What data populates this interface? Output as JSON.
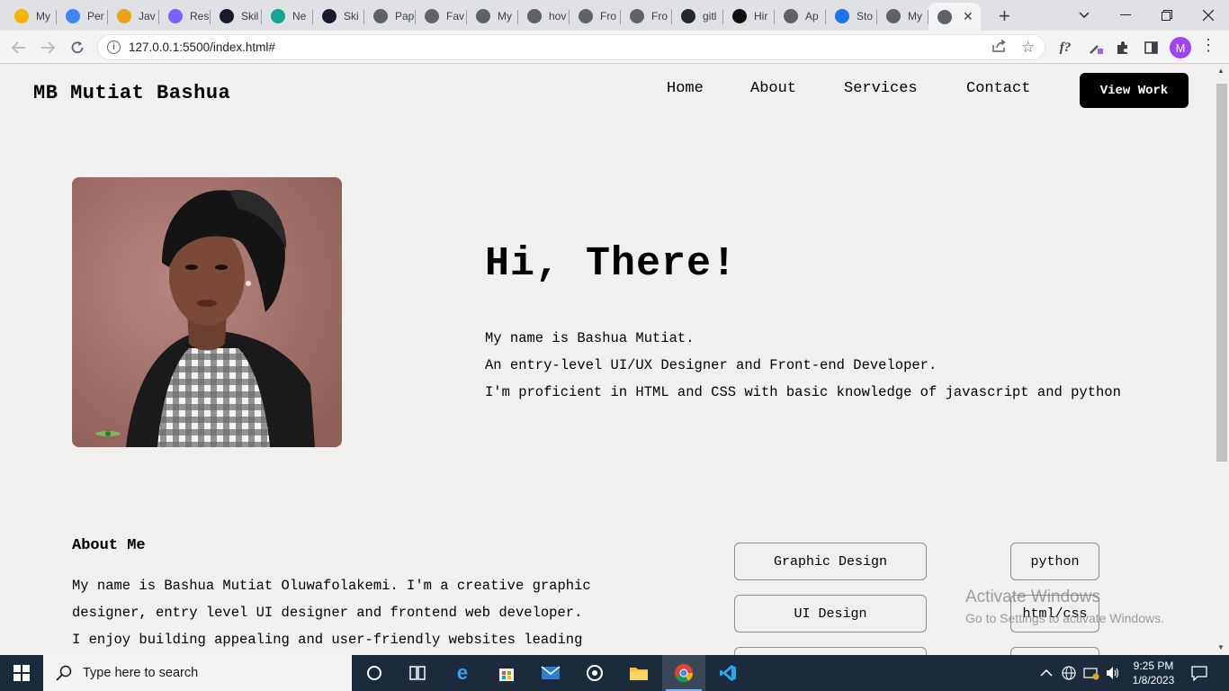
{
  "browser": {
    "tabs": [
      {
        "label": "My",
        "icon": "google-drive-icon",
        "color": "#f4b400"
      },
      {
        "label": "Per",
        "icon": "google-docs-icon",
        "color": "#4285f4"
      },
      {
        "label": "Jav",
        "icon": "javascript-icon",
        "color": "#e8a317"
      },
      {
        "label": "Res",
        "icon": "resource-icon",
        "color": "#7b61ff"
      },
      {
        "label": "Skil",
        "icon": "skillshare-icon",
        "color": "#1a1a2e"
      },
      {
        "label": "Ne",
        "icon": "netlify-icon",
        "color": "#16a394"
      },
      {
        "label": "Ski",
        "icon": "skillshare-icon",
        "color": "#1a1a2e"
      },
      {
        "label": "Pap",
        "icon": "globe-icon",
        "color": "#5f6368"
      },
      {
        "label": "Fav",
        "icon": "globe-icon",
        "color": "#5f6368"
      },
      {
        "label": "My",
        "icon": "globe-icon",
        "color": "#5f6368"
      },
      {
        "label": "hov",
        "icon": "globe-icon",
        "color": "#5f6368"
      },
      {
        "label": "Fro",
        "icon": "globe-icon",
        "color": "#5f6368"
      },
      {
        "label": "Fro",
        "icon": "globe-icon",
        "color": "#5f6368"
      },
      {
        "label": "gitl",
        "icon": "github-icon",
        "color": "#24292e"
      },
      {
        "label": "Hir",
        "icon": "hire-icon",
        "color": "#111111"
      },
      {
        "label": "Ap",
        "icon": "globe-icon",
        "color": "#5f6368"
      },
      {
        "label": "Sto",
        "icon": "storage-icon",
        "color": "#1a73e8"
      },
      {
        "label": "My",
        "icon": "globe-icon",
        "color": "#5f6368"
      }
    ],
    "url": "127.0.0.1:5500/index.html#",
    "profile_initial": "M"
  },
  "site": {
    "brand": "MB Mutiat Bashua",
    "nav": [
      {
        "label": "Home"
      },
      {
        "label": "About"
      },
      {
        "label": "Services"
      },
      {
        "label": "Contact"
      }
    ],
    "cta": "View Work"
  },
  "hero": {
    "title": "Hi, There!",
    "lines": [
      "My name is Bashua Mutiat.",
      "An entry-level UI/UX Designer and Front-end Developer.",
      "I'm proficient in HTML and CSS with basic knowledge of javascript and python"
    ]
  },
  "about": {
    "title": "About Me",
    "lines": [
      "My name is Bashua Mutiat Oluwafolakemi. I'm a creative graphic",
      "designer, entry level UI designer and frontend web developer.",
      "I enjoy building appealing and user-friendly websites leading"
    ]
  },
  "skills": {
    "left": [
      "Graphic Design",
      "UI Design"
    ],
    "right": [
      "python",
      "html/css"
    ]
  },
  "watermark": {
    "line1": "Activate Windows",
    "line2": "Go to Settings to activate Windows."
  },
  "taskbar": {
    "search_placeholder": "Type here to search",
    "time": "9:25 PM",
    "date": "1/8/2023"
  }
}
